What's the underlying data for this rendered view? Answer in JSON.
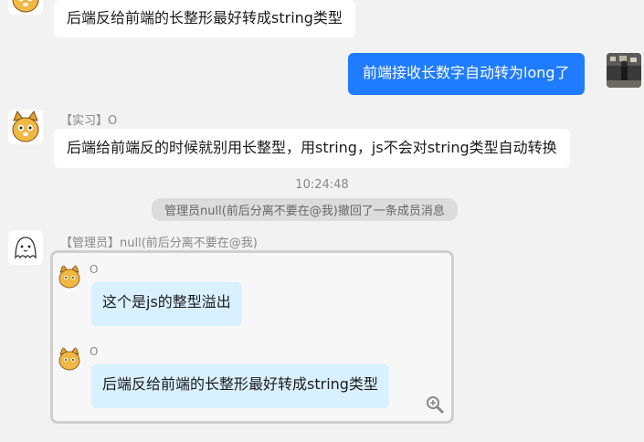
{
  "messages": {
    "m1": {
      "text": "后端反给前端的长整形最好转成string类型"
    },
    "m2": {
      "text": "前端接收长数字自动转为long了"
    },
    "m3": {
      "sender": "【实习】O",
      "text": "后端给前端反的时候就别用长整型，用string，js不会对string类型自动转换"
    },
    "timestamp": "10:24:48",
    "system": "管理员null(前后分离不要在@我)撤回了一条成员消息",
    "m4": {
      "sender": "【管理员】null(前后分离不要在@我)",
      "forward": {
        "items": [
          {
            "name": "O",
            "text": "这个是js的整型溢出"
          },
          {
            "name": "O",
            "text": "后端反给前端的长整形最好转成string类型"
          }
        ]
      }
    }
  },
  "icons": {
    "cat_avatar": "cat-avatar-icon",
    "ghost_avatar": "ghost-avatar-icon",
    "photo_avatar": "photo-avatar-icon",
    "zoom": "zoom-in-icon"
  },
  "colors": {
    "background": "#f2f2f2",
    "self_bubble": "#1f7bff",
    "forward_bubble": "#d9f0ff",
    "system_pill": "#dcdcdc"
  }
}
